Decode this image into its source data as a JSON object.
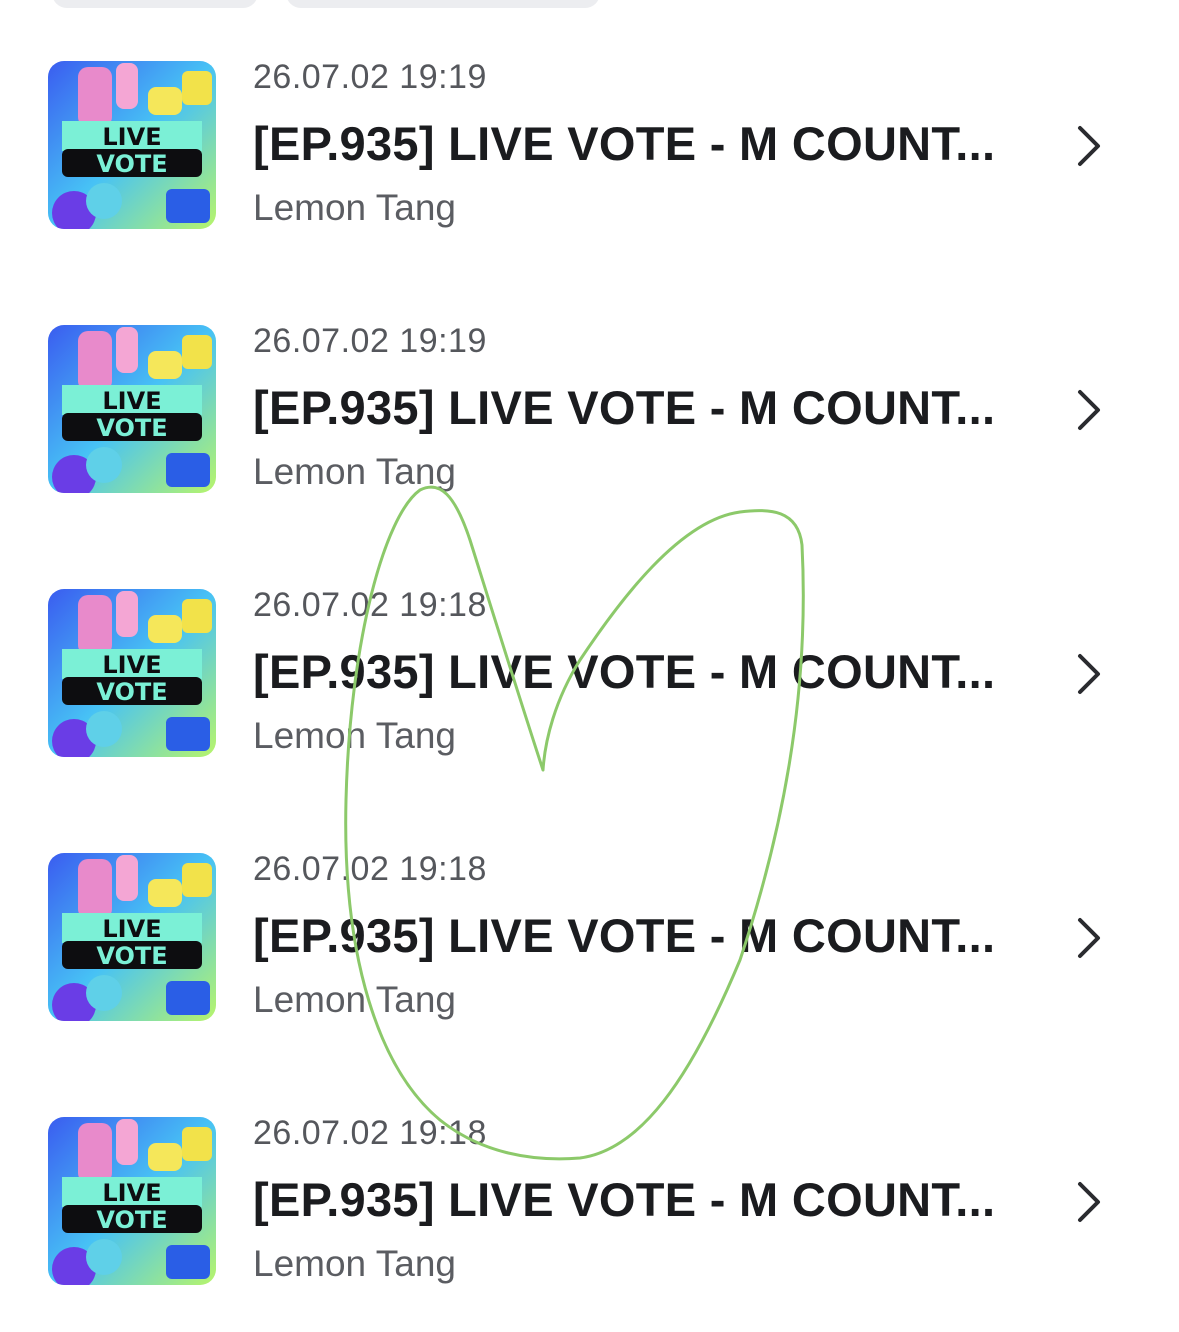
{
  "items": [
    {
      "date": "26.07.02 19:19",
      "title": "[EP.935] LIVE VOTE - M COUNT...",
      "author": "Lemon Tang",
      "thumb_line1": "LIVE",
      "thumb_line2": "VOTE"
    },
    {
      "date": "26.07.02 19:19",
      "title": "[EP.935] LIVE VOTE - M COUNT...",
      "author": "Lemon Tang",
      "thumb_line1": "LIVE",
      "thumb_line2": "VOTE"
    },
    {
      "date": "26.07.02 19:18",
      "title": "[EP.935] LIVE VOTE - M COUNT...",
      "author": "Lemon Tang",
      "thumb_line1": "LIVE",
      "thumb_line2": "VOTE"
    },
    {
      "date": "26.07.02 19:18",
      "title": "[EP.935] LIVE VOTE - M COUNT...",
      "author": "Lemon Tang",
      "thumb_line1": "LIVE",
      "thumb_line2": "VOTE"
    },
    {
      "date": "26.07.02 19:18",
      "title": "[EP.935] LIVE VOTE - M COUNT...",
      "author": "Lemon Tang",
      "thumb_line1": "LIVE",
      "thumb_line2": "VOTE"
    }
  ],
  "icons": {
    "chevron": "chevron-right-icon",
    "thumbnail": "live-vote-thumbnail"
  },
  "colors": {
    "heart_stroke": "#8cc96a",
    "title": "#1b1c1f",
    "meta": "#55575c"
  }
}
